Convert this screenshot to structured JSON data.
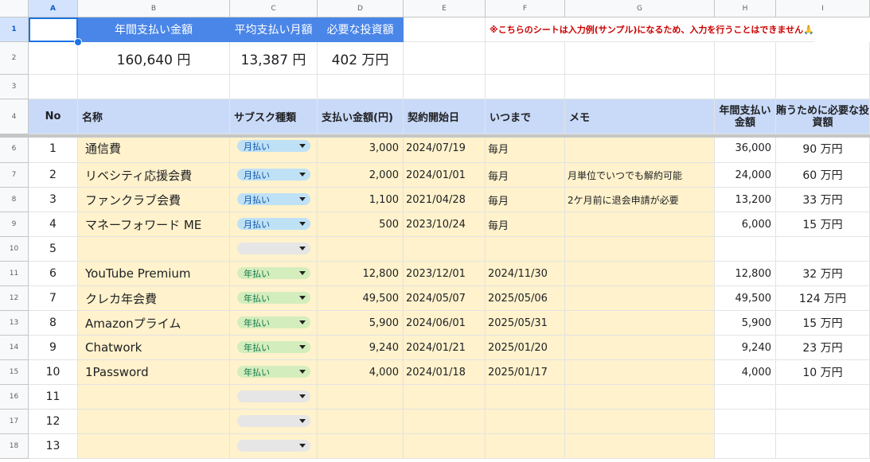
{
  "columns": [
    "A",
    "B",
    "C",
    "D",
    "E",
    "F",
    "G",
    "H",
    "I"
  ],
  "row_numbers": [
    "1",
    "2",
    "3",
    "4",
    "6",
    "7",
    "8",
    "9",
    "10",
    "11",
    "12",
    "13",
    "14",
    "15",
    "16",
    "17",
    "18"
  ],
  "summary": {
    "headers": [
      "年間支払い金額",
      "平均支払い月額",
      "必要な投資額"
    ],
    "values": [
      "160,640 円",
      "13,387 円",
      "402 万円"
    ],
    "notice": "※こちらのシートは入力例(サンプル)になるため、入力を行うことはできません🙏"
  },
  "table_headers": {
    "no": "No",
    "name": "名称",
    "type": "サブスク種類",
    "amount": "支払い金額(円)",
    "start": "契約開始日",
    "until": "いつまで",
    "memo": "メモ",
    "annual": "年間支払い金額",
    "invest": "賄うために必要な投資額"
  },
  "rows": [
    {
      "no": "1",
      "name": "通信費",
      "type": "月払い",
      "kind": "m",
      "amount": "3,000",
      "start": "2024/07/19",
      "until": "毎月",
      "memo": "",
      "annual": "36,000",
      "invest": "90 万円"
    },
    {
      "no": "2",
      "name": "リベシティ応援会費",
      "type": "月払い",
      "kind": "m",
      "amount": "2,000",
      "start": "2024/01/01",
      "until": "毎月",
      "memo": "月単位でいつでも解約可能",
      "annual": "24,000",
      "invest": "60 万円"
    },
    {
      "no": "3",
      "name": "ファンクラブ会費",
      "type": "月払い",
      "kind": "m",
      "amount": "1,100",
      "start": "2021/04/28",
      "until": "毎月",
      "memo": "2ケ月前に退会申請が必要",
      "annual": "13,200",
      "invest": "33 万円"
    },
    {
      "no": "4",
      "name": "マネーフォワード ME",
      "type": "月払い",
      "kind": "m",
      "amount": "500",
      "start": "2023/10/24",
      "until": "毎月",
      "memo": "",
      "annual": "6,000",
      "invest": "15 万円"
    },
    {
      "no": "5",
      "name": "",
      "type": "",
      "kind": "e",
      "amount": "",
      "start": "",
      "until": "",
      "memo": "",
      "annual": "",
      "invest": ""
    },
    {
      "no": "6",
      "name": "YouTube Premium",
      "type": "年払い",
      "kind": "y",
      "amount": "12,800",
      "start": "2023/12/01",
      "until": "2024/11/30",
      "memo": "",
      "annual": "12,800",
      "invest": "32 万円"
    },
    {
      "no": "7",
      "name": "クレカ年会費",
      "type": "年払い",
      "kind": "y",
      "amount": "49,500",
      "start": "2024/05/07",
      "until": "2025/05/06",
      "memo": "",
      "annual": "49,500",
      "invest": "124 万円"
    },
    {
      "no": "8",
      "name": "Amazonプライム",
      "type": "年払い",
      "kind": "y",
      "amount": "5,900",
      "start": "2024/06/01",
      "until": "2025/05/31",
      "memo": "",
      "annual": "5,900",
      "invest": "15 万円"
    },
    {
      "no": "9",
      "name": "Chatwork",
      "type": "年払い",
      "kind": "y",
      "amount": "9,240",
      "start": "2024/01/21",
      "until": "2025/01/20",
      "memo": "",
      "annual": "9,240",
      "invest": "23 万円"
    },
    {
      "no": "10",
      "name": "1Password",
      "type": "年払い",
      "kind": "y",
      "amount": "4,000",
      "start": "2024/01/18",
      "until": "2025/01/17",
      "memo": "",
      "annual": "4,000",
      "invest": "10 万円"
    },
    {
      "no": "11",
      "name": "",
      "type": "",
      "kind": "e",
      "amount": "",
      "start": "",
      "until": "",
      "memo": "",
      "annual": "",
      "invest": ""
    },
    {
      "no": "12",
      "name": "",
      "type": "",
      "kind": "e",
      "amount": "",
      "start": "",
      "until": "",
      "memo": "",
      "annual": "",
      "invest": ""
    },
    {
      "no": "13",
      "name": "",
      "type": "",
      "kind": "e",
      "amount": "",
      "start": "",
      "until": "",
      "memo": "",
      "annual": "",
      "invest": ""
    }
  ],
  "colors": {
    "header_blue": "#4a86e8",
    "table_header": "#c9daf8",
    "cream": "#fff2cc",
    "monthly_chip": "#bfe1f6",
    "yearly_chip": "#d4edbc",
    "notice_red": "#cc0000",
    "selection": "#1a73e8"
  }
}
